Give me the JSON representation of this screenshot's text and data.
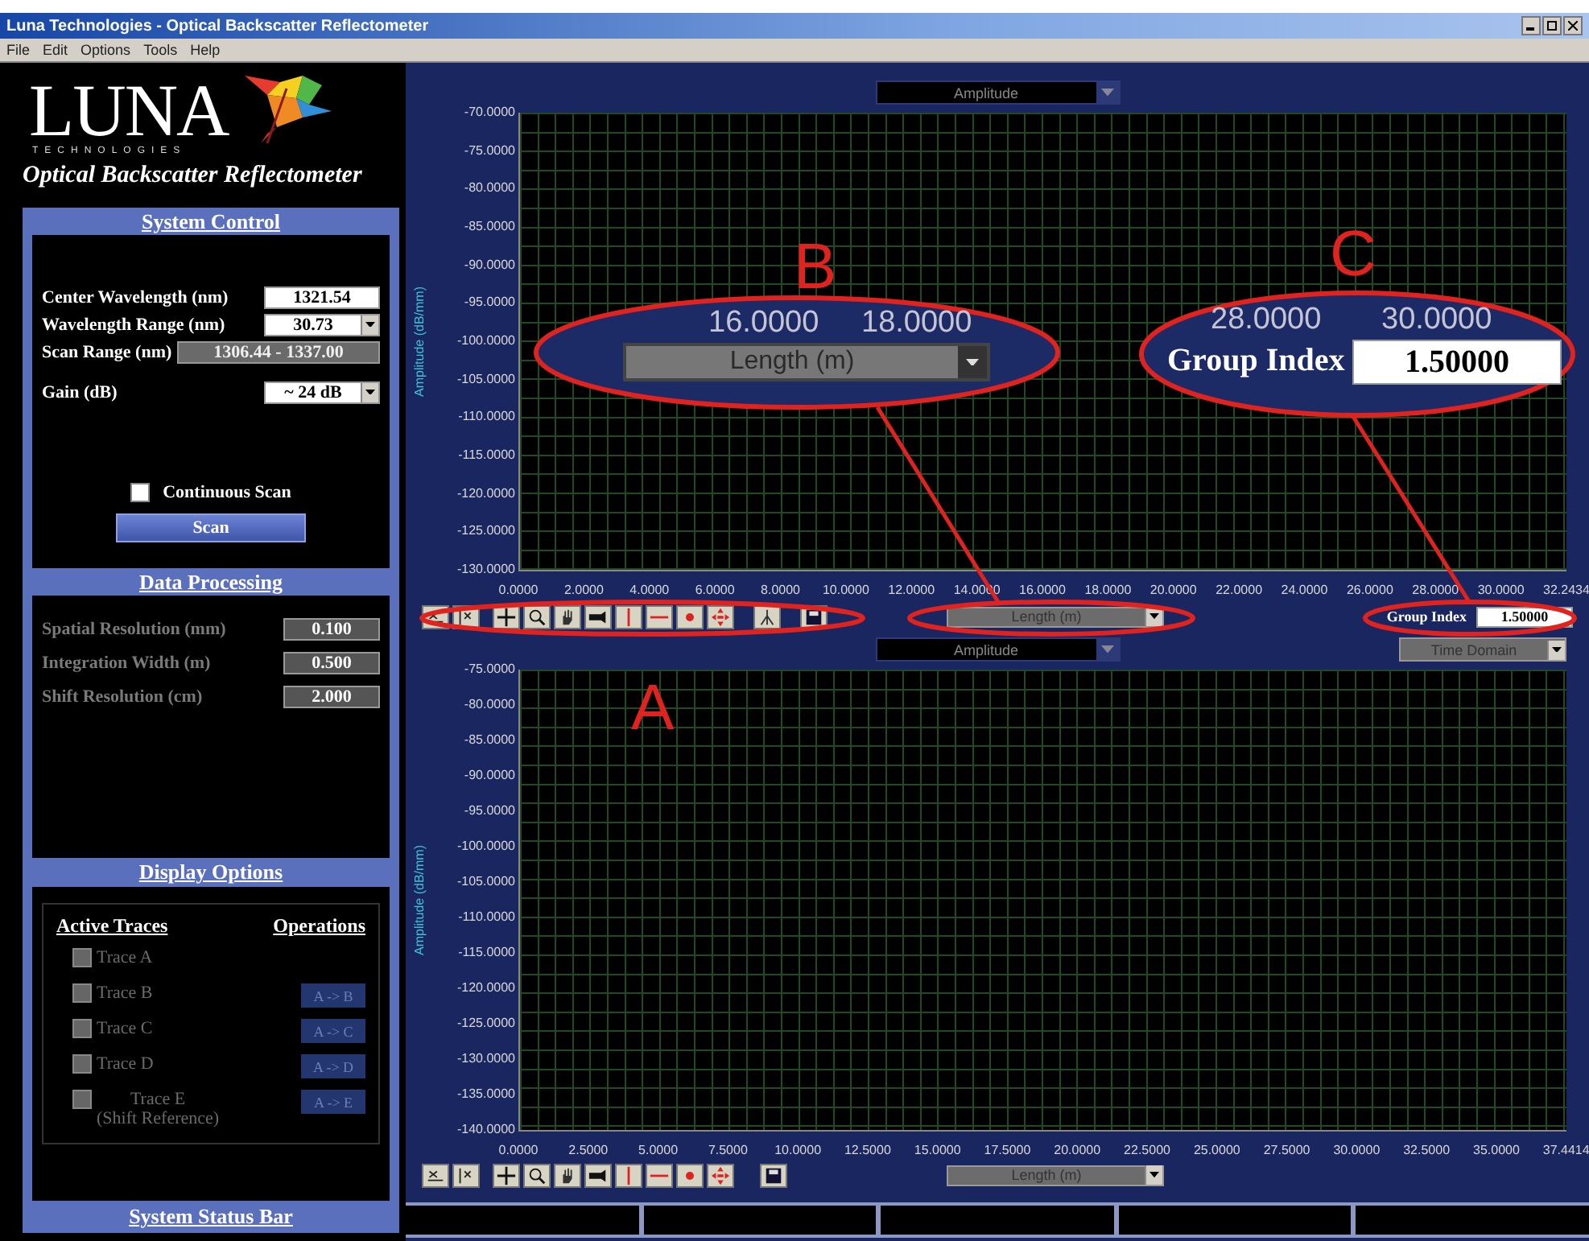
{
  "window": {
    "title": "Luna Technologies - Optical Backscatter Reflectometer"
  },
  "menu": [
    {
      "label": "File"
    },
    {
      "label": "Edit"
    },
    {
      "label": "Options"
    },
    {
      "label": "Tools"
    },
    {
      "label": "Help"
    }
  ],
  "logo": {
    "wordmark": "LUNA",
    "tagline": "TECHNOLOGIES"
  },
  "app_title": "Optical Backscatter Reflectometer",
  "system_control": {
    "heading": "System Control",
    "fields": [
      {
        "label": "Center Wavelength (nm)",
        "value": "1321.54",
        "kind": "input"
      },
      {
        "label": "Wavelength Range (nm)",
        "value": "30.73",
        "kind": "dropdown"
      },
      {
        "label": "Scan Range (nm)",
        "value": "1306.44 - 1337.00",
        "kind": "readout"
      },
      {
        "label": "Gain (dB)",
        "value": "~ 24 dB",
        "kind": "dropdown"
      }
    ],
    "continuous_scan": {
      "label": "Continuous Scan",
      "checked": false
    },
    "scan_button": {
      "label": "Scan"
    }
  },
  "data_processing": {
    "heading": "Data Processing",
    "fields": [
      {
        "label": "Spatial Resolution (mm)",
        "value": "0.100",
        "disabled": true
      },
      {
        "label": "Integration Width (m)",
        "value": "0.500",
        "disabled": true
      },
      {
        "label": "Shift Resolution (cm)",
        "value": "2.000",
        "disabled": true
      }
    ]
  },
  "display_options": {
    "heading": "Display Options",
    "traces_heading": "Active Traces",
    "operations_heading": "Operations",
    "traces": [
      {
        "label": "Trace A",
        "disabled": true
      },
      {
        "label": "Trace B",
        "disabled": true,
        "operation": "A -> B"
      },
      {
        "label": "Trace C",
        "disabled": true,
        "operation": "A -> C"
      },
      {
        "label": "Trace D",
        "disabled": true,
        "operation": "A -> D"
      },
      {
        "label": "Trace E",
        "note": "(Shift Reference)",
        "disabled": true,
        "operation": "A -> E"
      }
    ]
  },
  "plots": [
    {
      "trace_selector": "Amplitude",
      "y_label": "Amplitude (dB/mm)",
      "y_ticks": [
        "-70.0000",
        "-75.0000",
        "-80.0000",
        "-85.0000",
        "-90.0000",
        "-95.0000",
        "-100.0000",
        "-105.0000",
        "-110.0000",
        "-115.0000",
        "-120.0000",
        "-125.0000",
        "-130.0000"
      ],
      "x_ticks": [
        "0.0000",
        "2.0000",
        "4.0000",
        "6.0000",
        "8.0000",
        "10.0000",
        "12.0000",
        "14.0000",
        "16.0000",
        "18.0000",
        "20.0000",
        "22.0000",
        "24.0000",
        "26.0000",
        "28.0000",
        "30.0000",
        "32.2434"
      ],
      "x_axis_selector": "Length (m)",
      "marker_tool": true,
      "group_index": {
        "label": "Group Index",
        "value": "1.50000"
      }
    },
    {
      "trace_selector": "Amplitude",
      "domain_selector": "Time Domain",
      "y_label": "Amplitude (dB/mm)",
      "y_ticks": [
        "-75.0000",
        "-80.0000",
        "-85.0000",
        "-90.0000",
        "-95.0000",
        "-100.0000",
        "-105.0000",
        "-110.0000",
        "-115.0000",
        "-120.0000",
        "-125.0000",
        "-130.0000",
        "-135.0000",
        "-140.0000"
      ],
      "x_ticks": [
        "0.0000",
        "2.5000",
        "5.0000",
        "7.5000",
        "10.0000",
        "12.5000",
        "15.0000",
        "17.5000",
        "20.0000",
        "22.5000",
        "25.0000",
        "27.5000",
        "30.0000",
        "32.5000",
        "35.0000",
        "37.4414"
      ],
      "x_axis_selector": "Length (m)",
      "marker_tool": false
    }
  ],
  "status_bar": {
    "heading": "System Status Bar"
  },
  "callouts": [
    {
      "letter": "A"
    },
    {
      "letter": "B",
      "inset": {
        "kind": "selector",
        "ticks": [
          "16.0000",
          "18.0000"
        ],
        "selector": "Length (m)"
      }
    },
    {
      "letter": "C",
      "inset": {
        "kind": "field",
        "ticks": [
          "28.0000",
          "30.0000"
        ],
        "label": "Group Index",
        "value": "1.50000"
      }
    }
  ]
}
